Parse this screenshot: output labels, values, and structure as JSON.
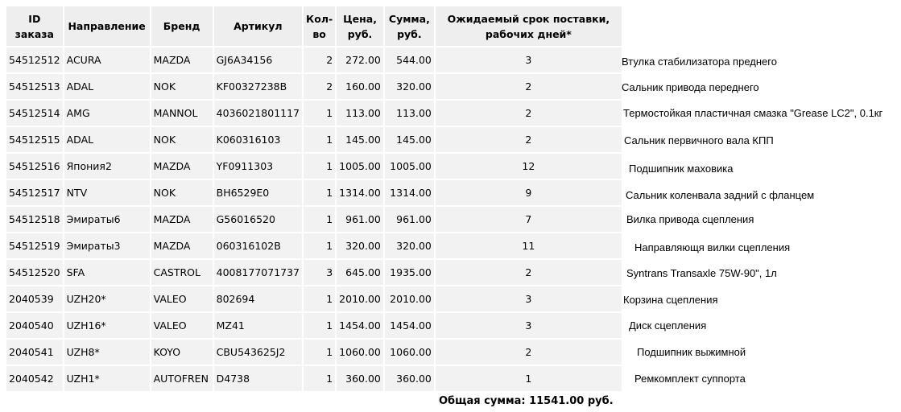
{
  "headers": {
    "id": "ID\nзаказа",
    "direction": "Направление",
    "brand": "Бренд",
    "article": "Артикул",
    "qty": "Кол-\nво",
    "price": "Цена,\nруб.",
    "sum": "Сумма,\nруб.",
    "days": "Ожидаемый срок поставки,\nрабочих дней*"
  },
  "rows": [
    {
      "id": "54512512",
      "direction": "ACURA",
      "brand": "MAZDA",
      "article": "GJ6A34156",
      "qty": "2",
      "price": "272.00",
      "sum": "544.00",
      "days": "3",
      "name": "Втулка стабилизатора преднего"
    },
    {
      "id": "54512513",
      "direction": "ADAL",
      "brand": "NOK",
      "article": "KF00327238B",
      "qty": "2",
      "price": "160.00",
      "sum": "320.00",
      "days": "2",
      "name": "Сальник привода переднего"
    },
    {
      "id": "54512514",
      "direction": "AMG",
      "brand": "MANNOL",
      "article": "4036021801117",
      "qty": "1",
      "price": "113.00",
      "sum": "113.00",
      "days": "2",
      "name": "Термостойкая пластичная смазка \"Grease LC2\", 0.1кг"
    },
    {
      "id": "54512515",
      "direction": "ADAL",
      "brand": "NOK",
      "article": "K060316103",
      "qty": "1",
      "price": "145.00",
      "sum": "145.00",
      "days": "2",
      "name": "Сальник первичного вала КПП"
    },
    {
      "id": "54512516",
      "direction": "Япония2",
      "brand": "MAZDA",
      "article": "YF0911303",
      "qty": "1",
      "price": "1005.00",
      "sum": "1005.00",
      "days": "12",
      "name": "Подшипник маховика"
    },
    {
      "id": "54512517",
      "direction": "NTV",
      "brand": "NOK",
      "article": "BH6529E0",
      "qty": "1",
      "price": "1314.00",
      "sum": "1314.00",
      "days": "9",
      "name": "Сальник коленвала задний с фланцем"
    },
    {
      "id": "54512518",
      "direction": "Эмираты6",
      "brand": "MAZDA",
      "article": "G56016520",
      "qty": "1",
      "price": "961.00",
      "sum": "961.00",
      "days": "7",
      "name": "Вилка привода сцепления"
    },
    {
      "id": "54512519",
      "direction": "Эмираты3",
      "brand": "MAZDA",
      "article": "060316102B",
      "qty": "1",
      "price": "320.00",
      "sum": "320.00",
      "days": "11",
      "name": "Направляющя вилки сцепления"
    },
    {
      "id": "54512520",
      "direction": "SFA",
      "brand": "CASTROL",
      "article": "4008177071737",
      "qty": "3",
      "price": "645.00",
      "sum": "1935.00",
      "days": "2",
      "name": "Syntrans Transaxle 75W-90\", 1л"
    },
    {
      "id": "2040539",
      "direction": "UZH20*",
      "brand": "VALEO",
      "article": "802694",
      "qty": "1",
      "price": "2010.00",
      "sum": "2010.00",
      "days": "3",
      "name": "Корзина сцепления"
    },
    {
      "id": "2040540",
      "direction": "UZH16*",
      "brand": "VALEO",
      "article": "MZ41",
      "qty": "1",
      "price": "1454.00",
      "sum": "1454.00",
      "days": "3",
      "name": "Диск сцепления"
    },
    {
      "id": "2040541",
      "direction": "UZH8*",
      "brand": "KOYO",
      "article": "CBU543625J2",
      "qty": "1",
      "price": "1060.00",
      "sum": "1060.00",
      "days": "2",
      "name": "Подшипник выжимной"
    },
    {
      "id": "2040542",
      "direction": "UZH1*",
      "brand": "AUTOFREN",
      "article": "D4738",
      "qty": "1",
      "price": "360.00",
      "sum": "360.00",
      "days": "1",
      "name": "Ремкомплект суппорта"
    }
  ],
  "total": "Общая сумма: 11541.00 руб."
}
